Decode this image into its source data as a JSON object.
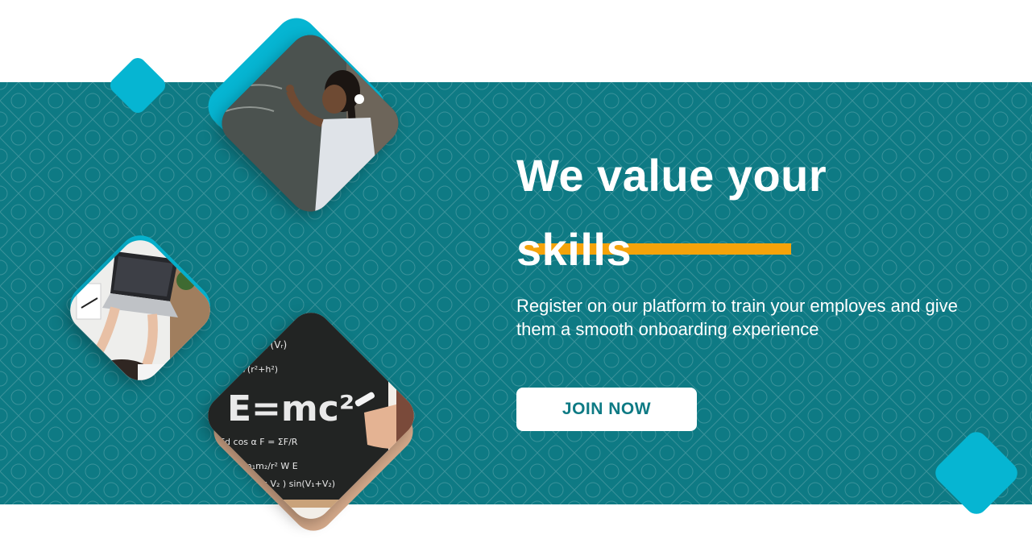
{
  "hero": {
    "headline_line1": "We value your",
    "headline_line2": "skills",
    "subtext": "Register on our platform to train your employes and give them a smooth onboarding experience",
    "cta_label": "JOIN NOW"
  },
  "photos": [
    {
      "name": "student-at-chalkboard-photo",
      "subject": "girl writing on blackboard"
    },
    {
      "name": "laptop-desk-photo",
      "subject": "person typing on laptop"
    },
    {
      "name": "physics-chalkboard-photo",
      "subject": "hand writing E=mc2 equations on chalkboard"
    }
  ],
  "colors": {
    "band": "#0e7a84",
    "accent_diamond": "#06b5d2",
    "underline": "#f5a30a",
    "button_text": "#0e7a84",
    "button_bg": "#ffffff"
  }
}
